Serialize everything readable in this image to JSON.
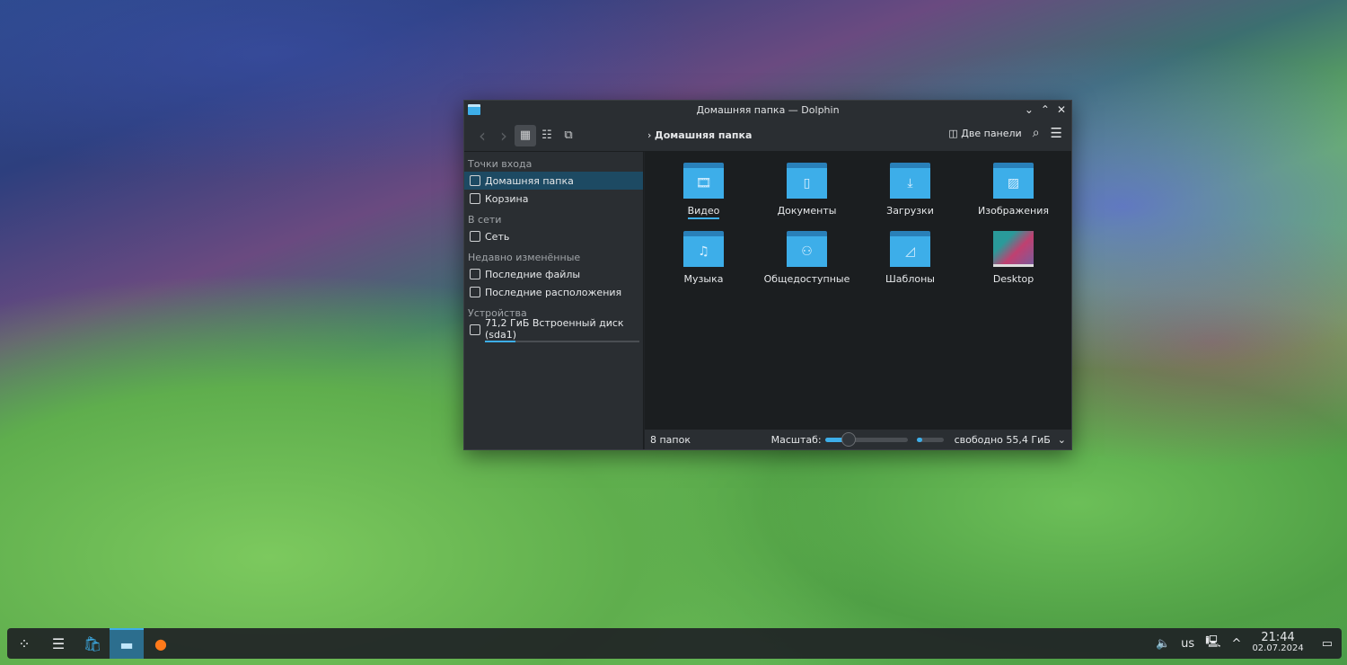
{
  "window": {
    "title": "Домашняя папка — Dolphin",
    "minimize": "⌄",
    "maximize": "⌃",
    "close": "✕"
  },
  "toolbar": {
    "back": "‹",
    "forward": "›",
    "breadcrumb": "Домашняя папка",
    "split_label": "Две панели"
  },
  "sidebar": {
    "sections": [
      {
        "title": "Точки входа",
        "items": [
          {
            "label": "Домашняя папка",
            "icon": "home-icon",
            "selected": true
          },
          {
            "label": "Корзина",
            "icon": "trash-icon"
          }
        ]
      },
      {
        "title": "В сети",
        "items": [
          {
            "label": "Сеть",
            "icon": "network-icon"
          }
        ]
      },
      {
        "title": "Недавно изменённые",
        "items": [
          {
            "label": "Последние файлы",
            "icon": "recent-files-icon"
          },
          {
            "label": "Последние расположения",
            "icon": "recent-locations-icon"
          }
        ]
      },
      {
        "title": "Устройства",
        "items": [
          {
            "label": "71,2 ГиБ Встроенный диск (sda1)",
            "icon": "drive-icon",
            "usage": 0.2
          }
        ]
      }
    ]
  },
  "files": [
    {
      "name": "Видео",
      "glyph": "🎞"
    },
    {
      "name": "Документы",
      "glyph": "▯"
    },
    {
      "name": "Загрузки",
      "glyph": "⤓"
    },
    {
      "name": "Изображения",
      "glyph": "▨"
    },
    {
      "name": "Музыка",
      "glyph": "♫"
    },
    {
      "name": "Общедоступные",
      "glyph": "⚇"
    },
    {
      "name": "Шаблоны",
      "glyph": "◿"
    },
    {
      "name": "Desktop"
    }
  ],
  "status": {
    "count": "8 папок",
    "zoom_label": "Масштаб:",
    "zoom_level": 0.25,
    "free": "свободно 55,4 ГиБ",
    "disk_used": 0.2
  },
  "taskbar": {
    "keyboard": "us",
    "time": "21:44",
    "date": "02.07.2024"
  },
  "colors": {
    "accent": "#3daee9",
    "selection": "#1d4a63"
  }
}
